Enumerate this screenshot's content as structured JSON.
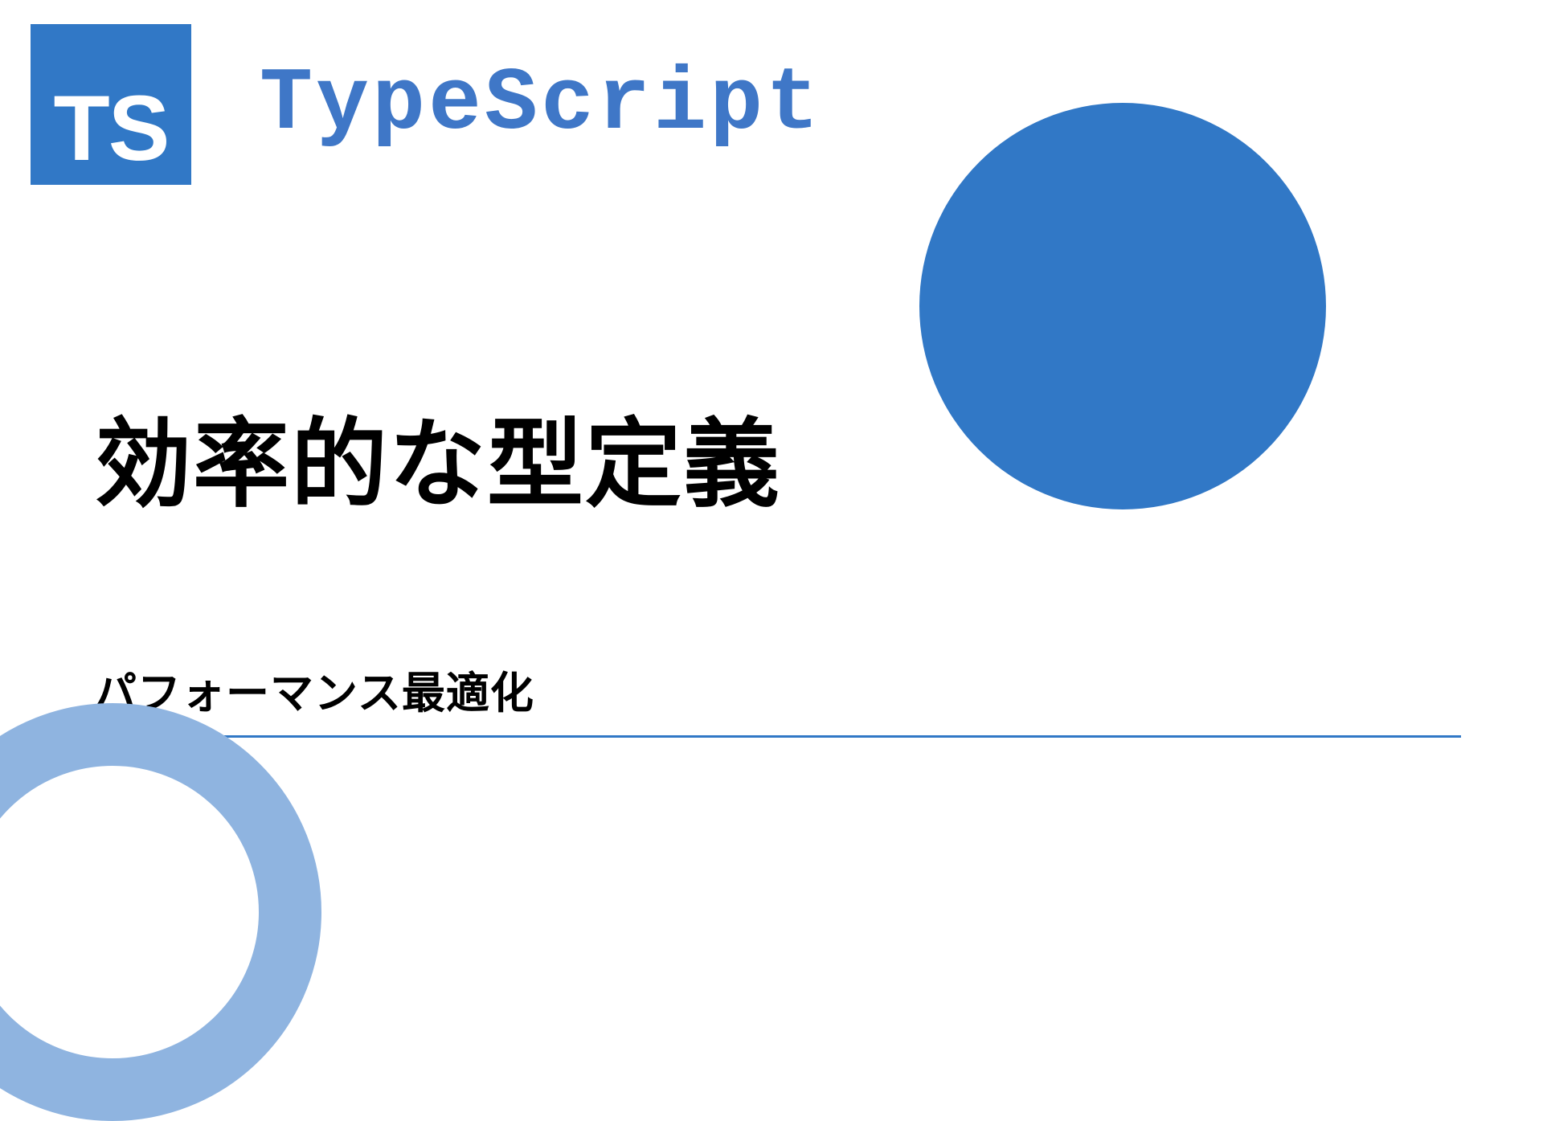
{
  "logo": {
    "badge_text": "TS",
    "brand_name": "TypeScript"
  },
  "main_title": "効率的な型定義",
  "subtitle": "パフォーマンス最適化",
  "colors": {
    "primary": "#3178c6",
    "accent_light": "#8fb4e0",
    "brand_text": "#3f77c7"
  }
}
